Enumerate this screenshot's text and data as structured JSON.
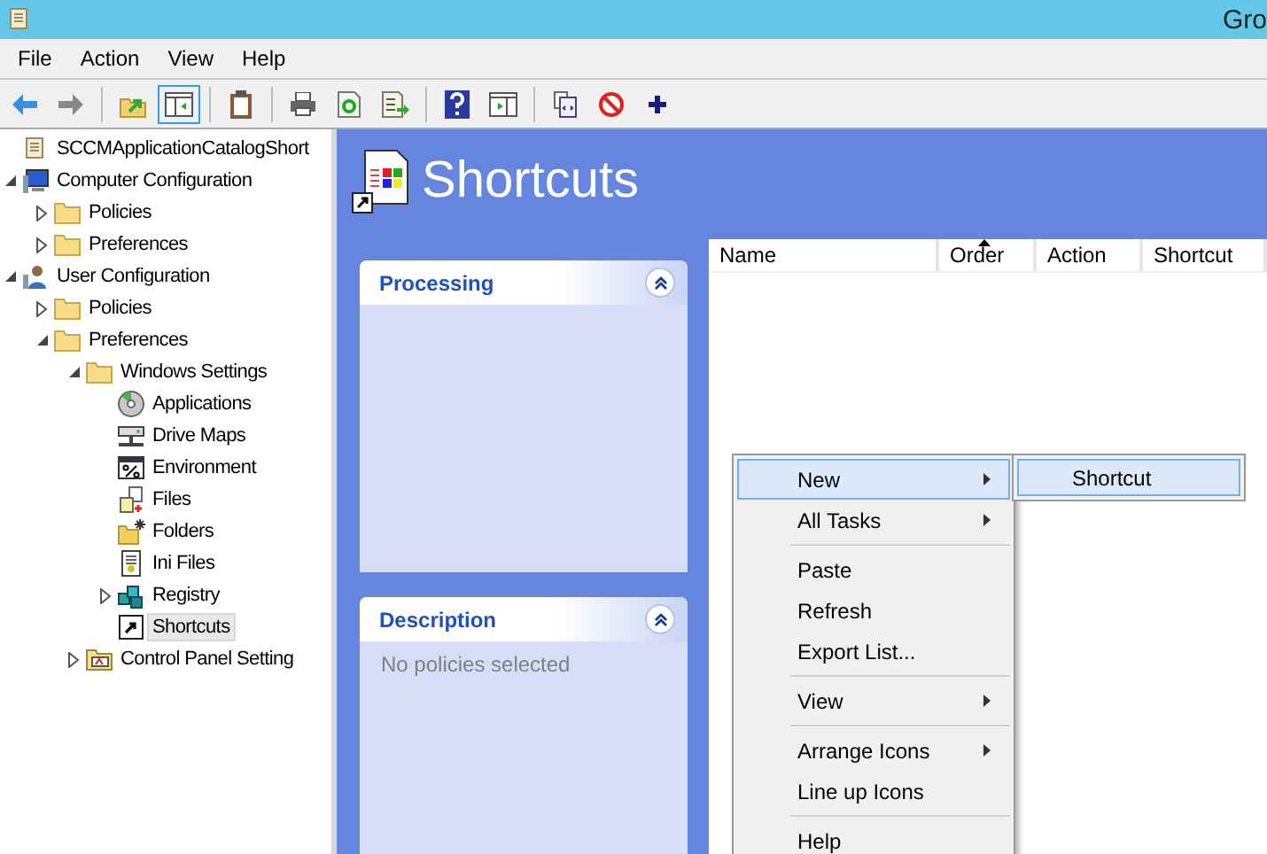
{
  "window": {
    "title": "Gro"
  },
  "menu_bar": [
    "File",
    "Action",
    "View",
    "Help"
  ],
  "toolbar": [
    {
      "kind": "back",
      "pressed": false
    },
    {
      "kind": "forward",
      "pressed": false
    },
    {
      "kind": "up",
      "pressed": false
    },
    {
      "kind": "console-tree",
      "pressed": true
    },
    {
      "kind": "clipboard",
      "pressed": false
    },
    {
      "kind": "print",
      "pressed": false
    },
    {
      "kind": "refresh",
      "pressed": false
    },
    {
      "kind": "export",
      "pressed": false
    },
    {
      "kind": "help",
      "pressed": false
    },
    {
      "kind": "action-pane",
      "pressed": false
    },
    {
      "kind": "properties",
      "pressed": false
    },
    {
      "kind": "stop",
      "pressed": false
    },
    {
      "kind": "add",
      "pressed": false
    }
  ],
  "tree": [
    {
      "label": "SCCMApplicationCatalogShort",
      "kind": "gpo",
      "selected": false,
      "children": [
        {
          "label": "Computer Configuration",
          "kind": "computer",
          "expanded": true,
          "selected": false,
          "children": [
            {
              "label": "Policies",
              "kind": "folder",
              "expanded": false,
              "selected": false
            },
            {
              "label": "Preferences",
              "kind": "folder",
              "expanded": false,
              "selected": false
            }
          ]
        },
        {
          "label": "User Configuration",
          "kind": "user",
          "expanded": true,
          "selected": false,
          "children": [
            {
              "label": "Policies",
              "kind": "folder",
              "expanded": false,
              "selected": false
            },
            {
              "label": "Preferences",
              "kind": "folder",
              "expanded": true,
              "selected": false,
              "children": [
                {
                  "label": "Windows Settings",
                  "kind": "folder",
                  "expanded": true,
                  "selected": false,
                  "children": [
                    {
                      "label": "Applications",
                      "kind": "disc",
                      "selected": false
                    },
                    {
                      "label": "Drive Maps",
                      "kind": "drive",
                      "selected": false
                    },
                    {
                      "label": "Environment",
                      "kind": "environment",
                      "selected": false
                    },
                    {
                      "label": "Files",
                      "kind": "files",
                      "selected": false
                    },
                    {
                      "label": "Folders",
                      "kind": "folders",
                      "selected": false
                    },
                    {
                      "label": "Ini Files",
                      "kind": "ini",
                      "selected": false
                    },
                    {
                      "label": "Registry",
                      "kind": "registry",
                      "expanded": false,
                      "selected": false
                    },
                    {
                      "label": "Shortcuts",
                      "kind": "shortcut",
                      "selected": true
                    }
                  ]
                },
                {
                  "label": "Control Panel Setting",
                  "kind": "control-panel",
                  "expanded": false,
                  "selected": false
                }
              ]
            }
          ]
        }
      ]
    }
  ],
  "header": {
    "title": "Shortcuts"
  },
  "panels": [
    {
      "title": "Processing",
      "expanded": true
    },
    {
      "title": "Description",
      "expanded": true,
      "text": "No policies selected"
    }
  ],
  "table": {
    "columns": [
      {
        "label": "Name",
        "sorted": false
      },
      {
        "label": "Order",
        "sorted": true
      },
      {
        "label": "Action",
        "sorted": false
      },
      {
        "label": "Shortcut",
        "sorted": false
      }
    ]
  },
  "context_menu": {
    "items": [
      {
        "kind": "item",
        "label": "New",
        "submenu": true,
        "selected": true
      },
      {
        "kind": "item",
        "label": "All Tasks",
        "submenu": true,
        "selected": false
      },
      {
        "kind": "separator"
      },
      {
        "kind": "item",
        "label": "Paste",
        "submenu": false,
        "selected": false
      },
      {
        "kind": "item",
        "label": "Refresh",
        "submenu": false,
        "selected": false
      },
      {
        "kind": "item",
        "label": "Export List...",
        "submenu": false,
        "selected": false
      },
      {
        "kind": "separator"
      },
      {
        "kind": "item",
        "label": "View",
        "submenu": true,
        "selected": false
      },
      {
        "kind": "separator"
      },
      {
        "kind": "item",
        "label": "Arrange Icons",
        "submenu": true,
        "selected": false
      },
      {
        "kind": "item",
        "label": "Line up Icons",
        "submenu": false,
        "selected": false
      },
      {
        "kind": "separator"
      },
      {
        "kind": "item",
        "label": "Help",
        "submenu": false,
        "selected": false
      }
    ],
    "submenu": [
      {
        "label": "Shortcut",
        "selected": true
      }
    ]
  }
}
